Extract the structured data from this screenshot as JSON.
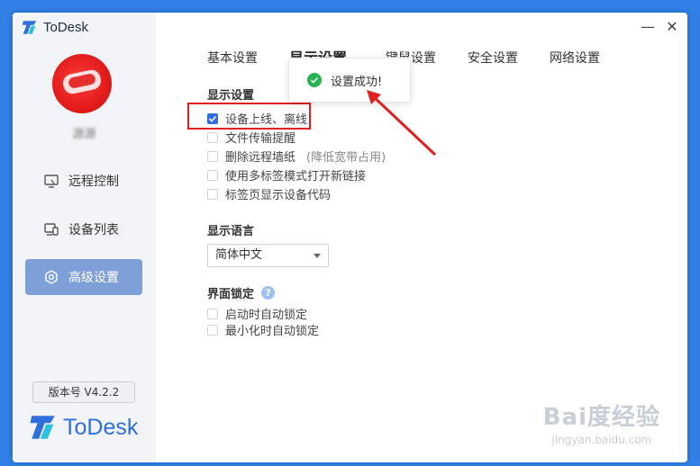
{
  "app": {
    "name": "ToDesk",
    "brand_color": "#2f6fdc"
  },
  "user": {
    "name": "源源"
  },
  "nav": [
    {
      "label": "远程控制",
      "icon": "monitor-icon"
    },
    {
      "label": "设备列表",
      "icon": "devices-icon"
    },
    {
      "label": "高级设置",
      "icon": "settings-hex-icon",
      "active": true
    }
  ],
  "version": "版本号 V4.2.2",
  "window_controls": {
    "minimize": "—",
    "close": "✕"
  },
  "tabs": [
    "基本设置",
    "显示设置",
    "键鼠设置",
    "安全设置",
    "网络设置"
  ],
  "display": {
    "title": "显示设置",
    "options": [
      {
        "label": "设备上线、离线",
        "checked": true
      },
      {
        "label": "文件传输提醒",
        "checked": false
      },
      {
        "label": "删除远程墙纸",
        "checked": false,
        "hint": "(降低宽带占用)"
      },
      {
        "label": "使用多标签模式打开新链接",
        "checked": false
      },
      {
        "label": "标签页显示设备代码",
        "checked": false
      }
    ]
  },
  "language": {
    "title": "显示语言",
    "selected": "简体中文"
  },
  "lock": {
    "title": "界面锁定",
    "options": [
      {
        "label": "启动时自动锁定",
        "checked": false
      },
      {
        "label": "最小化时自动锁定",
        "checked": false
      }
    ]
  },
  "toast": {
    "message": "设置成功!"
  },
  "watermark": {
    "main": "Bai度经验",
    "sub": "jingyan.baidu.com"
  }
}
